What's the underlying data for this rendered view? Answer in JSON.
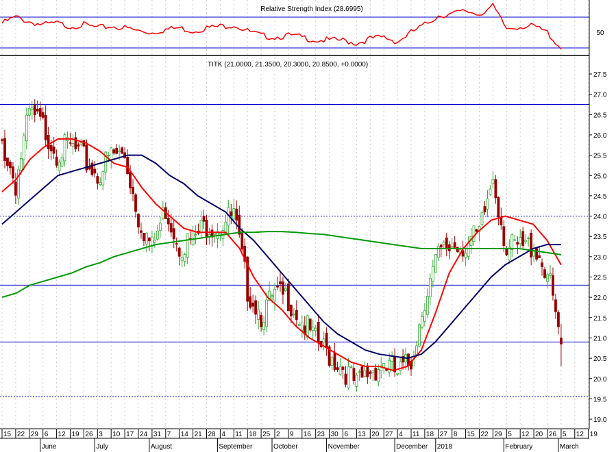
{
  "chart_data": {
    "type": "candlestick",
    "ticker_label": "TITK (21.0000, 21.3500, 20.3000, 20.8500, +0.0000)",
    "rsi_label": "Relative Strength Index (28.6995)",
    "rsi_level_label": "50",
    "rsi_levels": [
      70,
      30
    ],
    "rsi_weekly": [
      62,
      70,
      64,
      60,
      62,
      58,
      60,
      56,
      58,
      56,
      52,
      50,
      54,
      56,
      52,
      56,
      58,
      60,
      52,
      46,
      44,
      46,
      44,
      40,
      40,
      40,
      36,
      42,
      44,
      38,
      50,
      60,
      72,
      74,
      78,
      74,
      84,
      55,
      58,
      58,
      50,
      28.7
    ],
    "ylim": [
      18.7,
      27.8
    ],
    "y_ticks": [
      "19.0",
      "19.5",
      "20.0",
      "20.5",
      "21.0",
      "21.5",
      "22.0",
      "22.5",
      "23.0",
      "23.5",
      "24.0",
      "24.5",
      "25.0",
      "25.5",
      "26.0",
      "26.5",
      "27.0",
      "27.5"
    ],
    "x_ticks": [
      "15",
      "22",
      "29",
      "6",
      "12",
      "19",
      "26",
      "3",
      "10",
      "17",
      "24",
      "31",
      "7",
      "14",
      "21",
      "28",
      "4",
      "11",
      "18",
      "25",
      "2",
      "9",
      "16",
      "23",
      "30",
      "6",
      "13",
      "20",
      "27",
      "4",
      "11",
      "18",
      "27",
      "8",
      "15",
      "22",
      "29",
      "5",
      "12",
      "20",
      "26",
      "5",
      "12",
      "19"
    ],
    "months": [
      {
        "label": "June",
        "week": 3
      },
      {
        "label": "July",
        "week": 7
      },
      {
        "label": "August",
        "week": 11
      },
      {
        "label": "September",
        "week": 16
      },
      {
        "label": "October",
        "week": 20
      },
      {
        "label": "November",
        "week": 24
      },
      {
        "label": "December",
        "week": 29
      },
      {
        "label": "2018",
        "week": 32
      },
      {
        "label": "February",
        "week": 37
      },
      {
        "label": "March",
        "week": 41
      }
    ],
    "weekly_close": [
      25.8,
      24.8,
      26.5,
      26.2,
      25.6,
      25.7,
      25.4,
      25.0,
      25.5,
      25.5,
      24.0,
      23.2,
      24.2,
      23.3,
      23.4,
      23.8,
      23.8,
      24.0,
      22.2,
      21.6,
      22.0,
      22.0,
      21.4,
      20.9,
      20.6,
      20.3,
      19.8,
      20.2,
      20.4,
      20.1,
      20.4,
      22.0,
      23.0,
      23.3,
      23.3,
      23.5,
      25.0,
      23.2,
      23.2,
      23.3,
      22.6,
      20.85
    ],
    "last_bar": {
      "open": 21.0,
      "high": 21.35,
      "low": 20.3,
      "close": 20.85
    },
    "series": [
      {
        "name": "short MA",
        "color": "#ff0000",
        "values": [
          24.6,
          24.9,
          25.4,
          25.7,
          25.9,
          25.9,
          25.8,
          25.6,
          25.3,
          25.2,
          24.7,
          24.3,
          24.0,
          23.7,
          23.6,
          23.6,
          23.6,
          23.2,
          22.5,
          22.0,
          21.7,
          21.3,
          21.0,
          20.8,
          20.6,
          20.4,
          20.3,
          20.3,
          20.2,
          20.3,
          20.7,
          21.6,
          22.6,
          23.2,
          23.6,
          23.9,
          24.0,
          23.9,
          23.8,
          23.4,
          22.8
        ]
      },
      {
        "name": "medium MA",
        "color": "#000066",
        "values": [
          23.8,
          24.1,
          24.4,
          24.7,
          25.0,
          25.1,
          25.2,
          25.3,
          25.4,
          25.5,
          25.5,
          25.3,
          25.0,
          24.8,
          24.5,
          24.3,
          24.1,
          23.7,
          23.4,
          23.0,
          22.6,
          22.2,
          21.8,
          21.4,
          21.1,
          20.9,
          20.7,
          20.6,
          20.55,
          20.5,
          20.6,
          20.9,
          21.3,
          21.7,
          22.1,
          22.5,
          22.8,
          23.0,
          23.2,
          23.3,
          23.3
        ]
      },
      {
        "name": "long MA",
        "color": "#009900",
        "values": [
          22.0,
          22.1,
          22.3,
          22.4,
          22.5,
          22.6,
          22.75,
          22.85,
          23.0,
          23.1,
          23.2,
          23.3,
          23.35,
          23.4,
          23.45,
          23.5,
          23.55,
          23.6,
          23.6,
          23.62,
          23.62,
          23.6,
          23.57,
          23.55,
          23.5,
          23.45,
          23.4,
          23.35,
          23.3,
          23.25,
          23.2,
          23.2,
          23.2,
          23.2,
          23.2,
          23.2,
          23.2,
          23.2,
          23.15,
          23.1,
          23.05
        ]
      }
    ],
    "horizontal_lines": [
      {
        "value": 26.75,
        "style": "solid"
      },
      {
        "value": 24.0,
        "style": "dotted"
      },
      {
        "value": 22.3,
        "style": "solid"
      },
      {
        "value": 20.9,
        "style": "solid"
      },
      {
        "value": 19.55,
        "style": "dotted"
      }
    ],
    "colors": {
      "up": "#33aa33",
      "down": "#990000",
      "hline": "#0000cc",
      "rsi": "#ff0000"
    }
  }
}
